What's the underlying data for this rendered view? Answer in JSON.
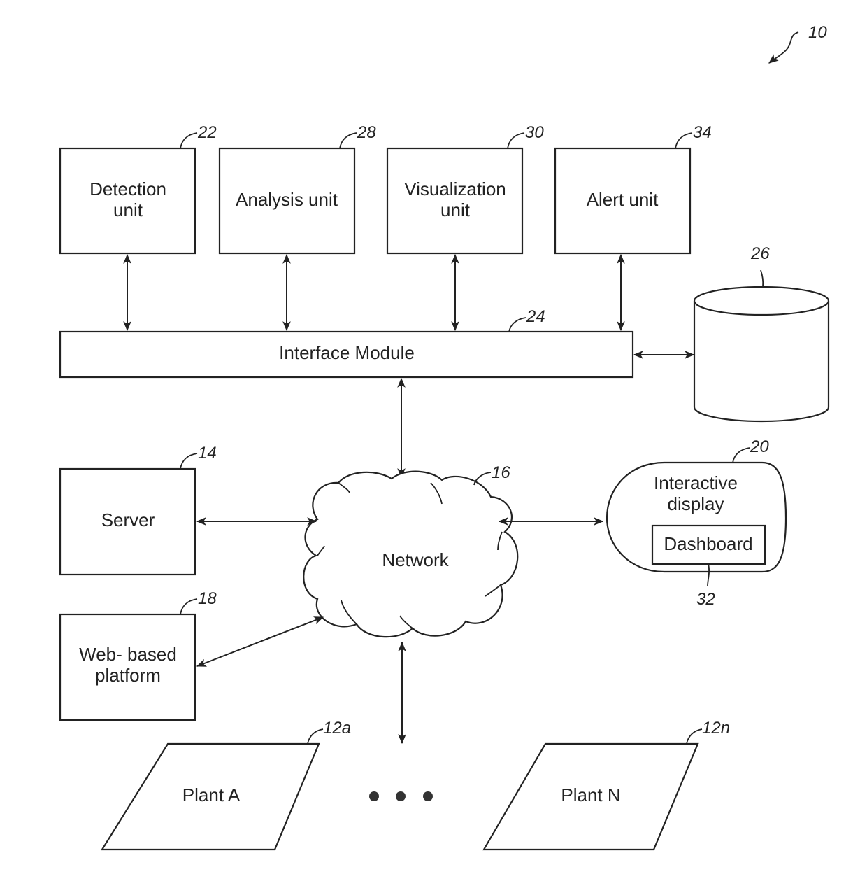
{
  "figure": {
    "ref_number": "10",
    "units": [
      {
        "id": "detection",
        "label_lines": [
          "Detection",
          "unit"
        ],
        "ref": "22"
      },
      {
        "id": "analysis",
        "label_lines": [
          "Analysis unit"
        ],
        "ref": "28"
      },
      {
        "id": "visualization",
        "label_lines": [
          "Visualization",
          "unit"
        ],
        "ref": "30"
      },
      {
        "id": "alert",
        "label_lines": [
          "Alert unit"
        ],
        "ref": "34"
      }
    ],
    "interface_module": {
      "label": "Interface Module",
      "ref": "24"
    },
    "database": {
      "ref": "26"
    },
    "server": {
      "label": "Server",
      "ref": "14"
    },
    "web_platform": {
      "label_lines": [
        "Web- based",
        "platform"
      ],
      "ref": "18"
    },
    "network": {
      "label": "Network",
      "ref": "16"
    },
    "interactive_display": {
      "label_lines": [
        "Interactive",
        "display"
      ],
      "ref": "20"
    },
    "dashboard": {
      "label": "Dashboard",
      "ref": "32"
    },
    "plants": [
      {
        "label": "Plant A",
        "ref": "12a"
      },
      {
        "label": "Plant N",
        "ref": "12n"
      }
    ]
  }
}
